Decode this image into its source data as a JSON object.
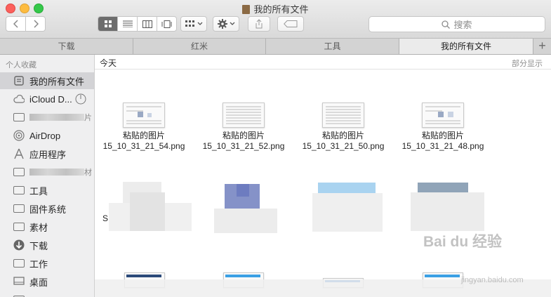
{
  "window": {
    "title": "我的所有文件"
  },
  "toolbar": {
    "search_placeholder": "搜索"
  },
  "tabs": [
    {
      "label": "下载"
    },
    {
      "label": "红米"
    },
    {
      "label": "工具"
    },
    {
      "label": "我的所有文件",
      "active": true
    }
  ],
  "sidebar": {
    "section_title": "个人收藏",
    "items": [
      {
        "label": "我的所有文件",
        "icon": "all-files-icon",
        "selected": true
      },
      {
        "label": "iCloud D...",
        "icon": "cloud-icon"
      },
      {
        "label": "",
        "icon": "folder-icon",
        "suffix": "片"
      },
      {
        "label": "AirDrop",
        "icon": "airdrop-icon"
      },
      {
        "label": "应用程序",
        "icon": "applications-icon"
      },
      {
        "label": "",
        "icon": "folder-icon",
        "suffix": "材"
      },
      {
        "label": "工具",
        "icon": "folder-icon"
      },
      {
        "label": "固件系统",
        "icon": "folder-icon"
      },
      {
        "label": "素材",
        "icon": "folder-icon"
      },
      {
        "label": "下载",
        "icon": "downloads-icon"
      },
      {
        "label": "工作",
        "icon": "folder-icon"
      },
      {
        "label": "桌面",
        "icon": "desktop-icon"
      }
    ]
  },
  "content": {
    "group_title": "今天",
    "group_action": "部分显示",
    "files": [
      {
        "line1": "粘贴的图片",
        "line2": "15_10_31_21_54.png"
      },
      {
        "line1": "粘贴的图片",
        "line2": "15_10_31_21_52.png"
      },
      {
        "line1": "粘贴的图片",
        "line2": "15_10_31_21_50.png"
      },
      {
        "line1": "粘贴的图片",
        "line2": "15_10_31_21_48.png"
      }
    ],
    "stray_letter": "S"
  },
  "watermark": {
    "text": "Bai du 经验",
    "sub": "jingyan.baidu.com"
  },
  "colors": {
    "selection": "#d3d3d6",
    "close": "#fc605c",
    "minimize": "#fdbc40",
    "maximize": "#34c84a"
  }
}
